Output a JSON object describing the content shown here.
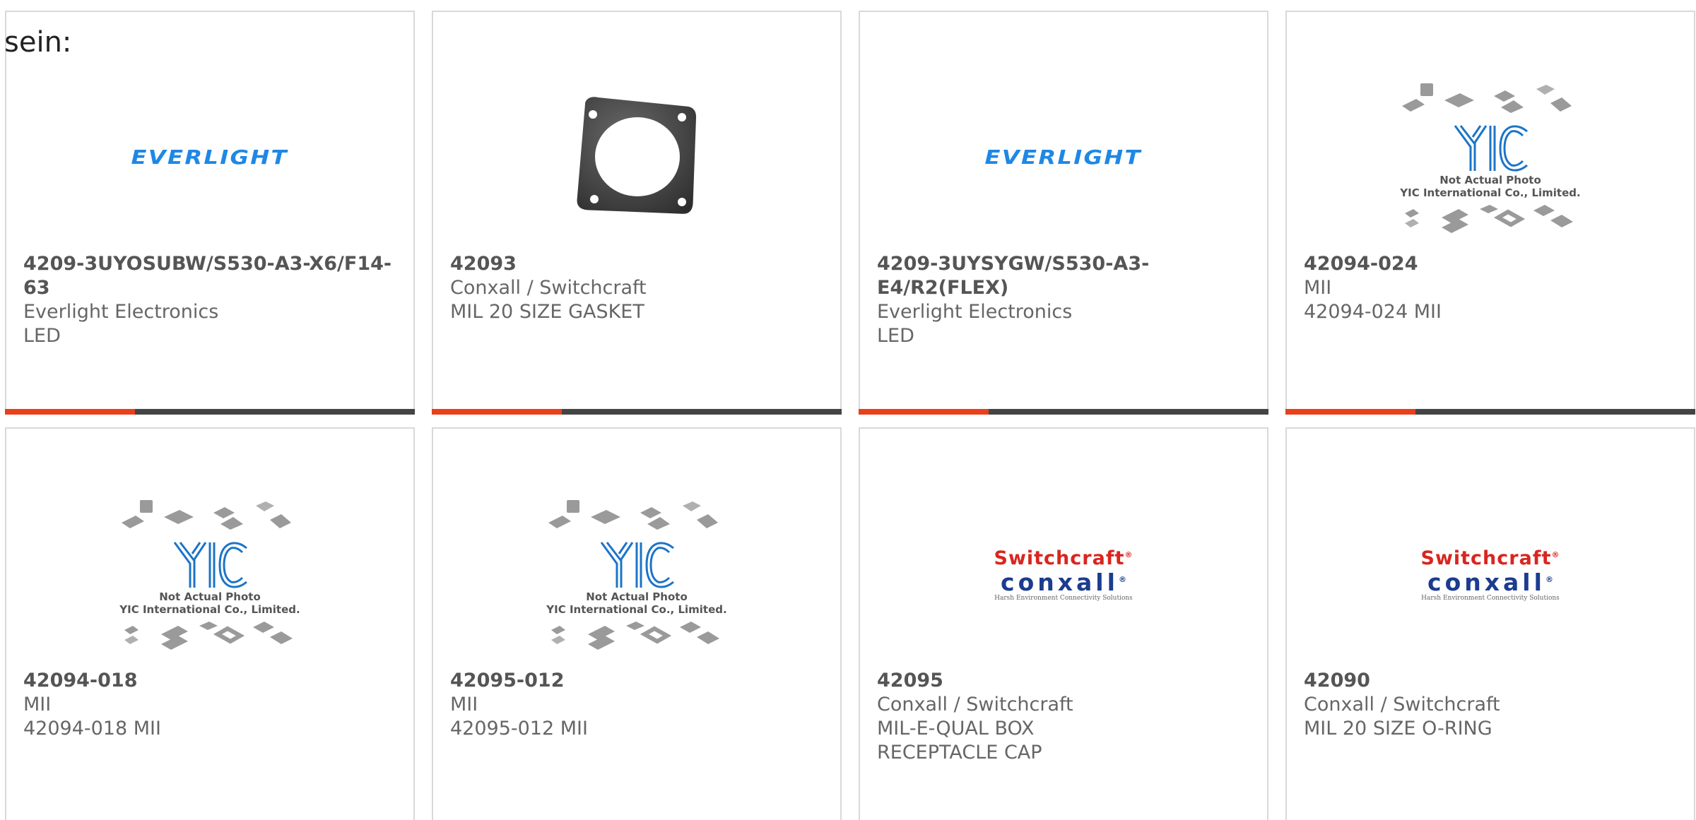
{
  "heading_fragment": "sein:",
  "colors": {
    "accent": "#e8401c",
    "bar": "#444444",
    "border": "#d9d9d9",
    "everlight_blue": "#1e88e5",
    "switchcraft_red": "#d8261f",
    "conxall_blue": "#1b3c8f"
  },
  "logos": {
    "everlight": "EVERLIGHT",
    "switchcraft": "Switchcraft",
    "switchcraft_mark": "®",
    "conxall": "conxall",
    "conxall_mark": "®",
    "conxall_tagline": "Harsh Environment Connectivity Solutions",
    "yic_line1": "Not Actual Photo",
    "yic_line2": "YIC International Co., Limited."
  },
  "products": [
    {
      "image": "everlight-logo",
      "part_number": "4209-3UYOSUBW/S530-A3-X6/F14-63",
      "manufacturer": "Everlight Electronics",
      "description": "LED"
    },
    {
      "image": "gasket-photo",
      "part_number": "42093",
      "manufacturer": "Conxall / Switchcraft",
      "description": "MIL 20 SIZE GASKET"
    },
    {
      "image": "everlight-logo",
      "part_number": "4209-3UYSYGW/S530-A3-E4/R2(FLEX)",
      "manufacturer": "Everlight Electronics",
      "description": "LED"
    },
    {
      "image": "yic-placeholder",
      "part_number": "42094-024",
      "manufacturer": "MII",
      "description": "42094-024 MII"
    },
    {
      "image": "yic-placeholder",
      "part_number": "42094-018",
      "manufacturer": "MII",
      "description": "42094-018 MII"
    },
    {
      "image": "yic-placeholder",
      "part_number": "42095-012",
      "manufacturer": "MII",
      "description": "42095-012 MII"
    },
    {
      "image": "switchcraft-conxall-logo",
      "part_number": "42095",
      "manufacturer": "Conxall / Switchcraft",
      "description": "MIL-E-QUAL BOX RECEPTACLE CAP"
    },
    {
      "image": "switchcraft-conxall-logo",
      "part_number": "42090",
      "manufacturer": "Conxall / Switchcraft",
      "description": "MIL 20 SIZE O-RING"
    }
  ]
}
